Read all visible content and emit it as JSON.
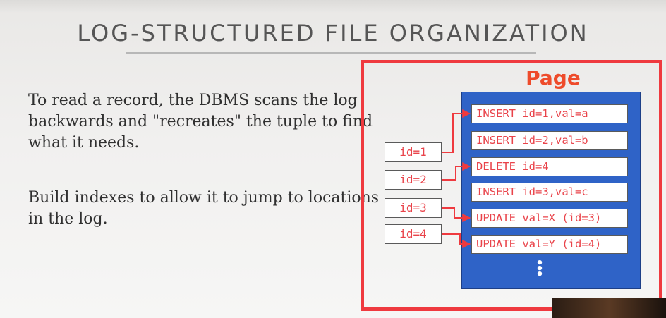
{
  "slide": {
    "title": "LOG-STRUCTURED FILE ORGANIZATION",
    "paragraphs": [
      "To read a record, the DBMS scans the log backwards and \"recreates\" the tuple to find what it needs.",
      "Build indexes to allow it to jump to locations in the log."
    ]
  },
  "diagram": {
    "page_label": "Page",
    "log_entries": [
      "INSERT id=1,val=a",
      "INSERT id=2,val=b",
      "DELETE id=4",
      "INSERT id=3,val=c",
      "UPDATE val=X (id=3)",
      "UPDATE val=Y (id=4)"
    ],
    "ellipsis": "⋮",
    "index_entries": [
      "id=1",
      "id=2",
      "id=3",
      "id=4"
    ],
    "index_links": [
      {
        "from": "id=1",
        "to": "INSERT id=1,val=a"
      },
      {
        "from": "id=2",
        "to": "DELETE id=4"
      },
      {
        "from": "id=3",
        "to": "UPDATE val=X (id=3)"
      },
      {
        "from": "id=4",
        "to": "UPDATE val=Y (id=4)"
      }
    ]
  },
  "colors": {
    "frame": "#ef3a3f",
    "page_fill": "#2f63c7",
    "entry_text": "#e9434a",
    "page_label": "#ee4b2b",
    "title_text": "#555555"
  }
}
